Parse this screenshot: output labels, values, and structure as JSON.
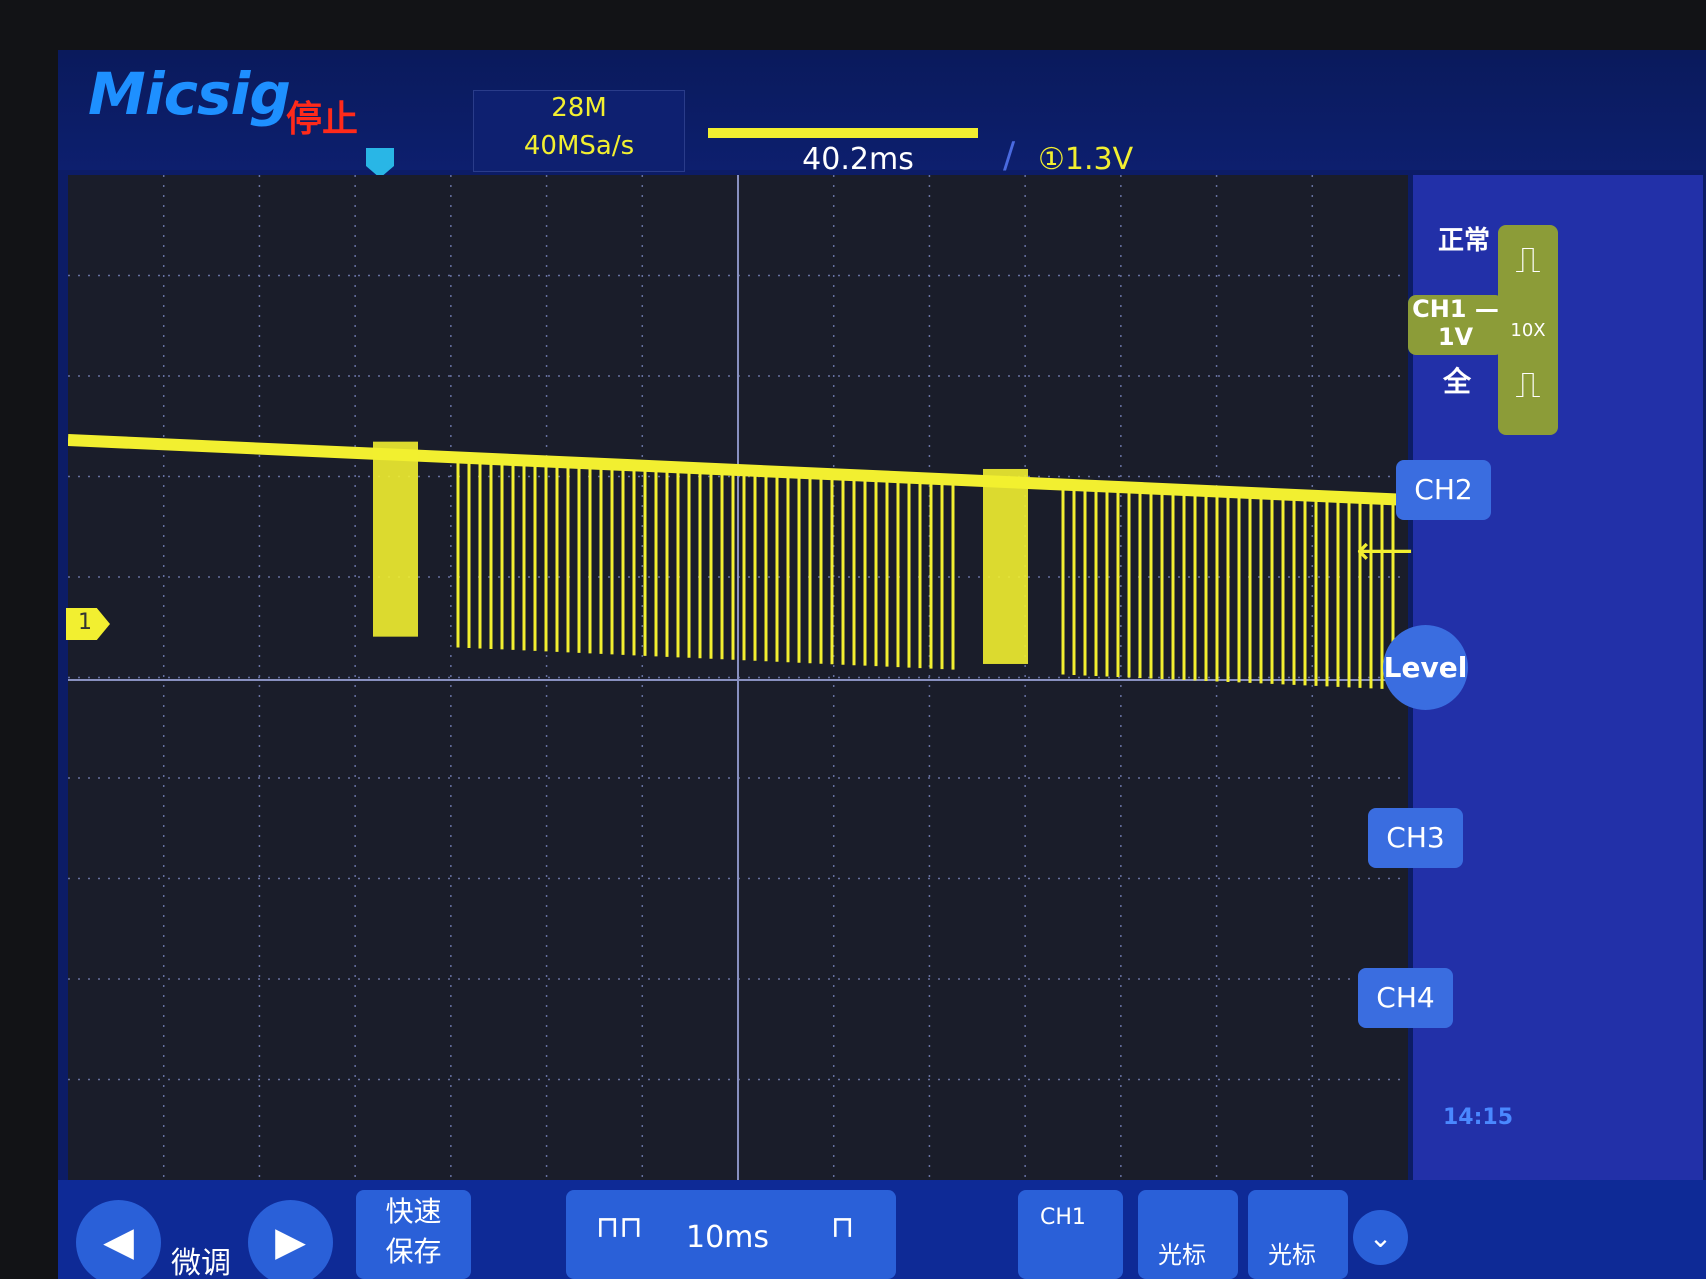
{
  "device": {
    "brand": "Micsig",
    "run_status": "停止"
  },
  "acquisition": {
    "memory_depth": "28M",
    "sample_rate": "40MSa/s"
  },
  "timebase": {
    "delay": "40.2ms",
    "scale": "10ms"
  },
  "trigger": {
    "source_level": "①1.3V",
    "mode": "正常"
  },
  "channel1": {
    "label": "CH1 —",
    "scale": "1V",
    "coupling": "全",
    "probe": "10X",
    "marker": "1"
  },
  "channels": [
    "CH2",
    "CH3",
    "CH4"
  ],
  "level_button": "Level",
  "clock": "14:15",
  "bottom": {
    "fine_label": "微调",
    "fast_label": "快速",
    "fast_label2": "保存",
    "timebase_scale": "10ms",
    "ch1_tag": "CH1",
    "cursor_label": "光标",
    "cursor_label2": "光标"
  },
  "colors": {
    "trace": "#f2ef30",
    "accent": "#3a6de0",
    "stop": "#ff2a1a",
    "ch1": "#8c9c38"
  }
}
